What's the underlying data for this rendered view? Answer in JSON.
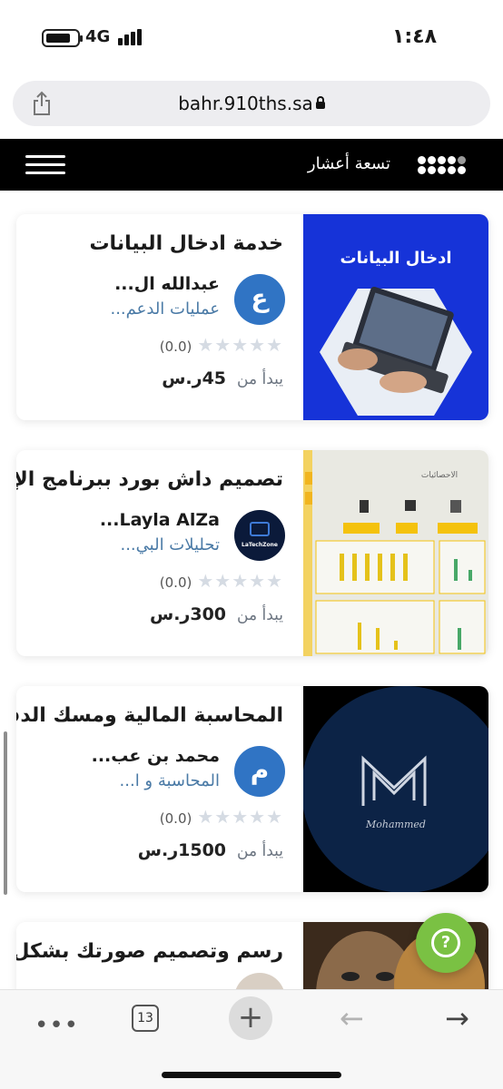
{
  "status_bar": {
    "time": "١:٤٨",
    "network": "4G"
  },
  "browser": {
    "url": "bahr.910ths.sa"
  },
  "site_header": {
    "brand": "تسعة أعشار"
  },
  "cards": [
    {
      "title": "خدمة ادخال البيانات",
      "thumb_text": "ادخال البيانات",
      "avatar_letter": "ع",
      "seller": "عبدالله ال...",
      "category": "عمليات الدعم...",
      "rating": "(0.0)",
      "price_prefix": "يبدأ من",
      "price": "45ر.س"
    },
    {
      "title": "تصميم داش بورد ببرنامج الإكسل",
      "thumb_text": "الاحصائيات",
      "avatar_logo_text": "LaTechZone",
      "seller": "Layla AlZa...",
      "category": "تحليلات البي...",
      "rating": "(0.0)",
      "price_prefix": "يبدأ من",
      "price": "300ر.س"
    },
    {
      "title": "المحاسبة المالية ومسك الدفاتر",
      "thumb_text": "Mohammed",
      "avatar_letter": "م",
      "seller": "محمد بن عب...",
      "category": "المحاسبة و ا...",
      "rating": "(0.0)",
      "price_prefix": "يبدأ من",
      "price": "1500ر.س"
    },
    {
      "title": "رسم وتصميم صورتك بشكل",
      "seller": "",
      "category": ""
    }
  ],
  "toolbar": {
    "tab_count": "13"
  },
  "colors": {
    "header_bg": "#000000",
    "avatar_blue": "#3074c4",
    "help_green": "#7ac143",
    "thumb1_bg": "#1633d8",
    "thumb3_bg": "#0c2346"
  }
}
